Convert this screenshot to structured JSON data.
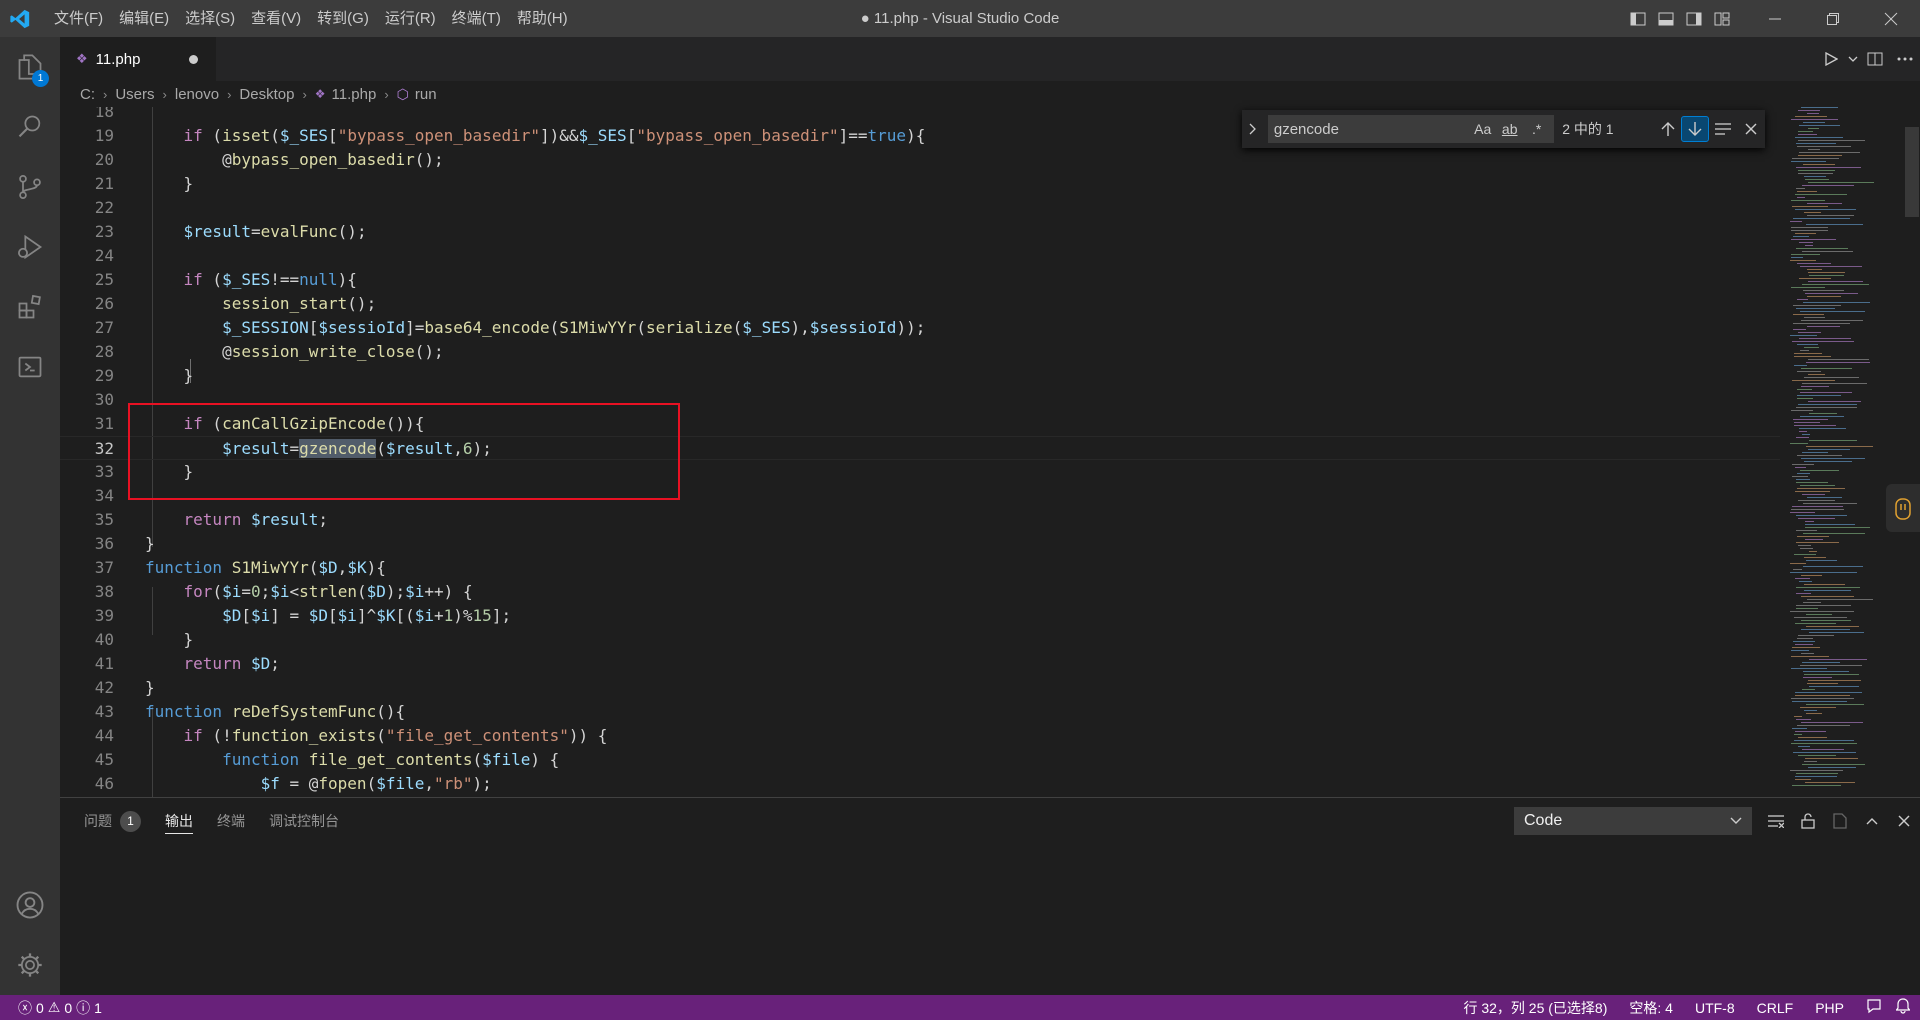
{
  "titlebar": {
    "menu": [
      "文件(F)",
      "编辑(E)",
      "选择(S)",
      "查看(V)",
      "转到(G)",
      "运行(R)",
      "终端(T)",
      "帮助(H)"
    ],
    "title": "● 11.php - Visual Studio Code"
  },
  "activitybar": {
    "explorer_badge": "1"
  },
  "tab": {
    "label": "11.php"
  },
  "breadcrumb": {
    "items": [
      "C:",
      "Users",
      "lenovo",
      "Desktop",
      "11.php",
      "run"
    ]
  },
  "find": {
    "query": "gzencode",
    "opt_case": "Aa",
    "opt_word": "ab",
    "opt_regex": ".*",
    "count": "2 中的 1"
  },
  "editor": {
    "current_line": 32,
    "lines": [
      {
        "n": "18"
      },
      {
        "n": "19"
      },
      {
        "n": "20"
      },
      {
        "n": "21"
      },
      {
        "n": "22"
      },
      {
        "n": "23"
      },
      {
        "n": "24"
      },
      {
        "n": "25"
      },
      {
        "n": "26"
      },
      {
        "n": "27"
      },
      {
        "n": "28"
      },
      {
        "n": "29"
      },
      {
        "n": "30"
      },
      {
        "n": "31"
      },
      {
        "n": "32"
      },
      {
        "n": "33"
      },
      {
        "n": "34"
      },
      {
        "n": "35"
      },
      {
        "n": "36"
      },
      {
        "n": "37"
      },
      {
        "n": "38"
      },
      {
        "n": "39"
      },
      {
        "n": "40"
      },
      {
        "n": "41"
      },
      {
        "n": "42"
      },
      {
        "n": "43"
      },
      {
        "n": "44"
      },
      {
        "n": "45"
      },
      {
        "n": "46"
      }
    ]
  },
  "panel": {
    "tabs": [
      "问题",
      "输出",
      "终端",
      "调试控制台"
    ],
    "problems_badge": "1",
    "output_channel": "Code"
  },
  "statusbar": {
    "errors": "0",
    "warnings": "0",
    "infos": "1",
    "position": "行 32，列 25 (已选择8)",
    "spaces": "空格: 4",
    "encoding": "UTF-8",
    "eol": "CRLF",
    "language": "PHP"
  },
  "colors": {
    "statusbar": "#68217a",
    "highlight_box": "#e81123",
    "accent": "#0078d4"
  }
}
